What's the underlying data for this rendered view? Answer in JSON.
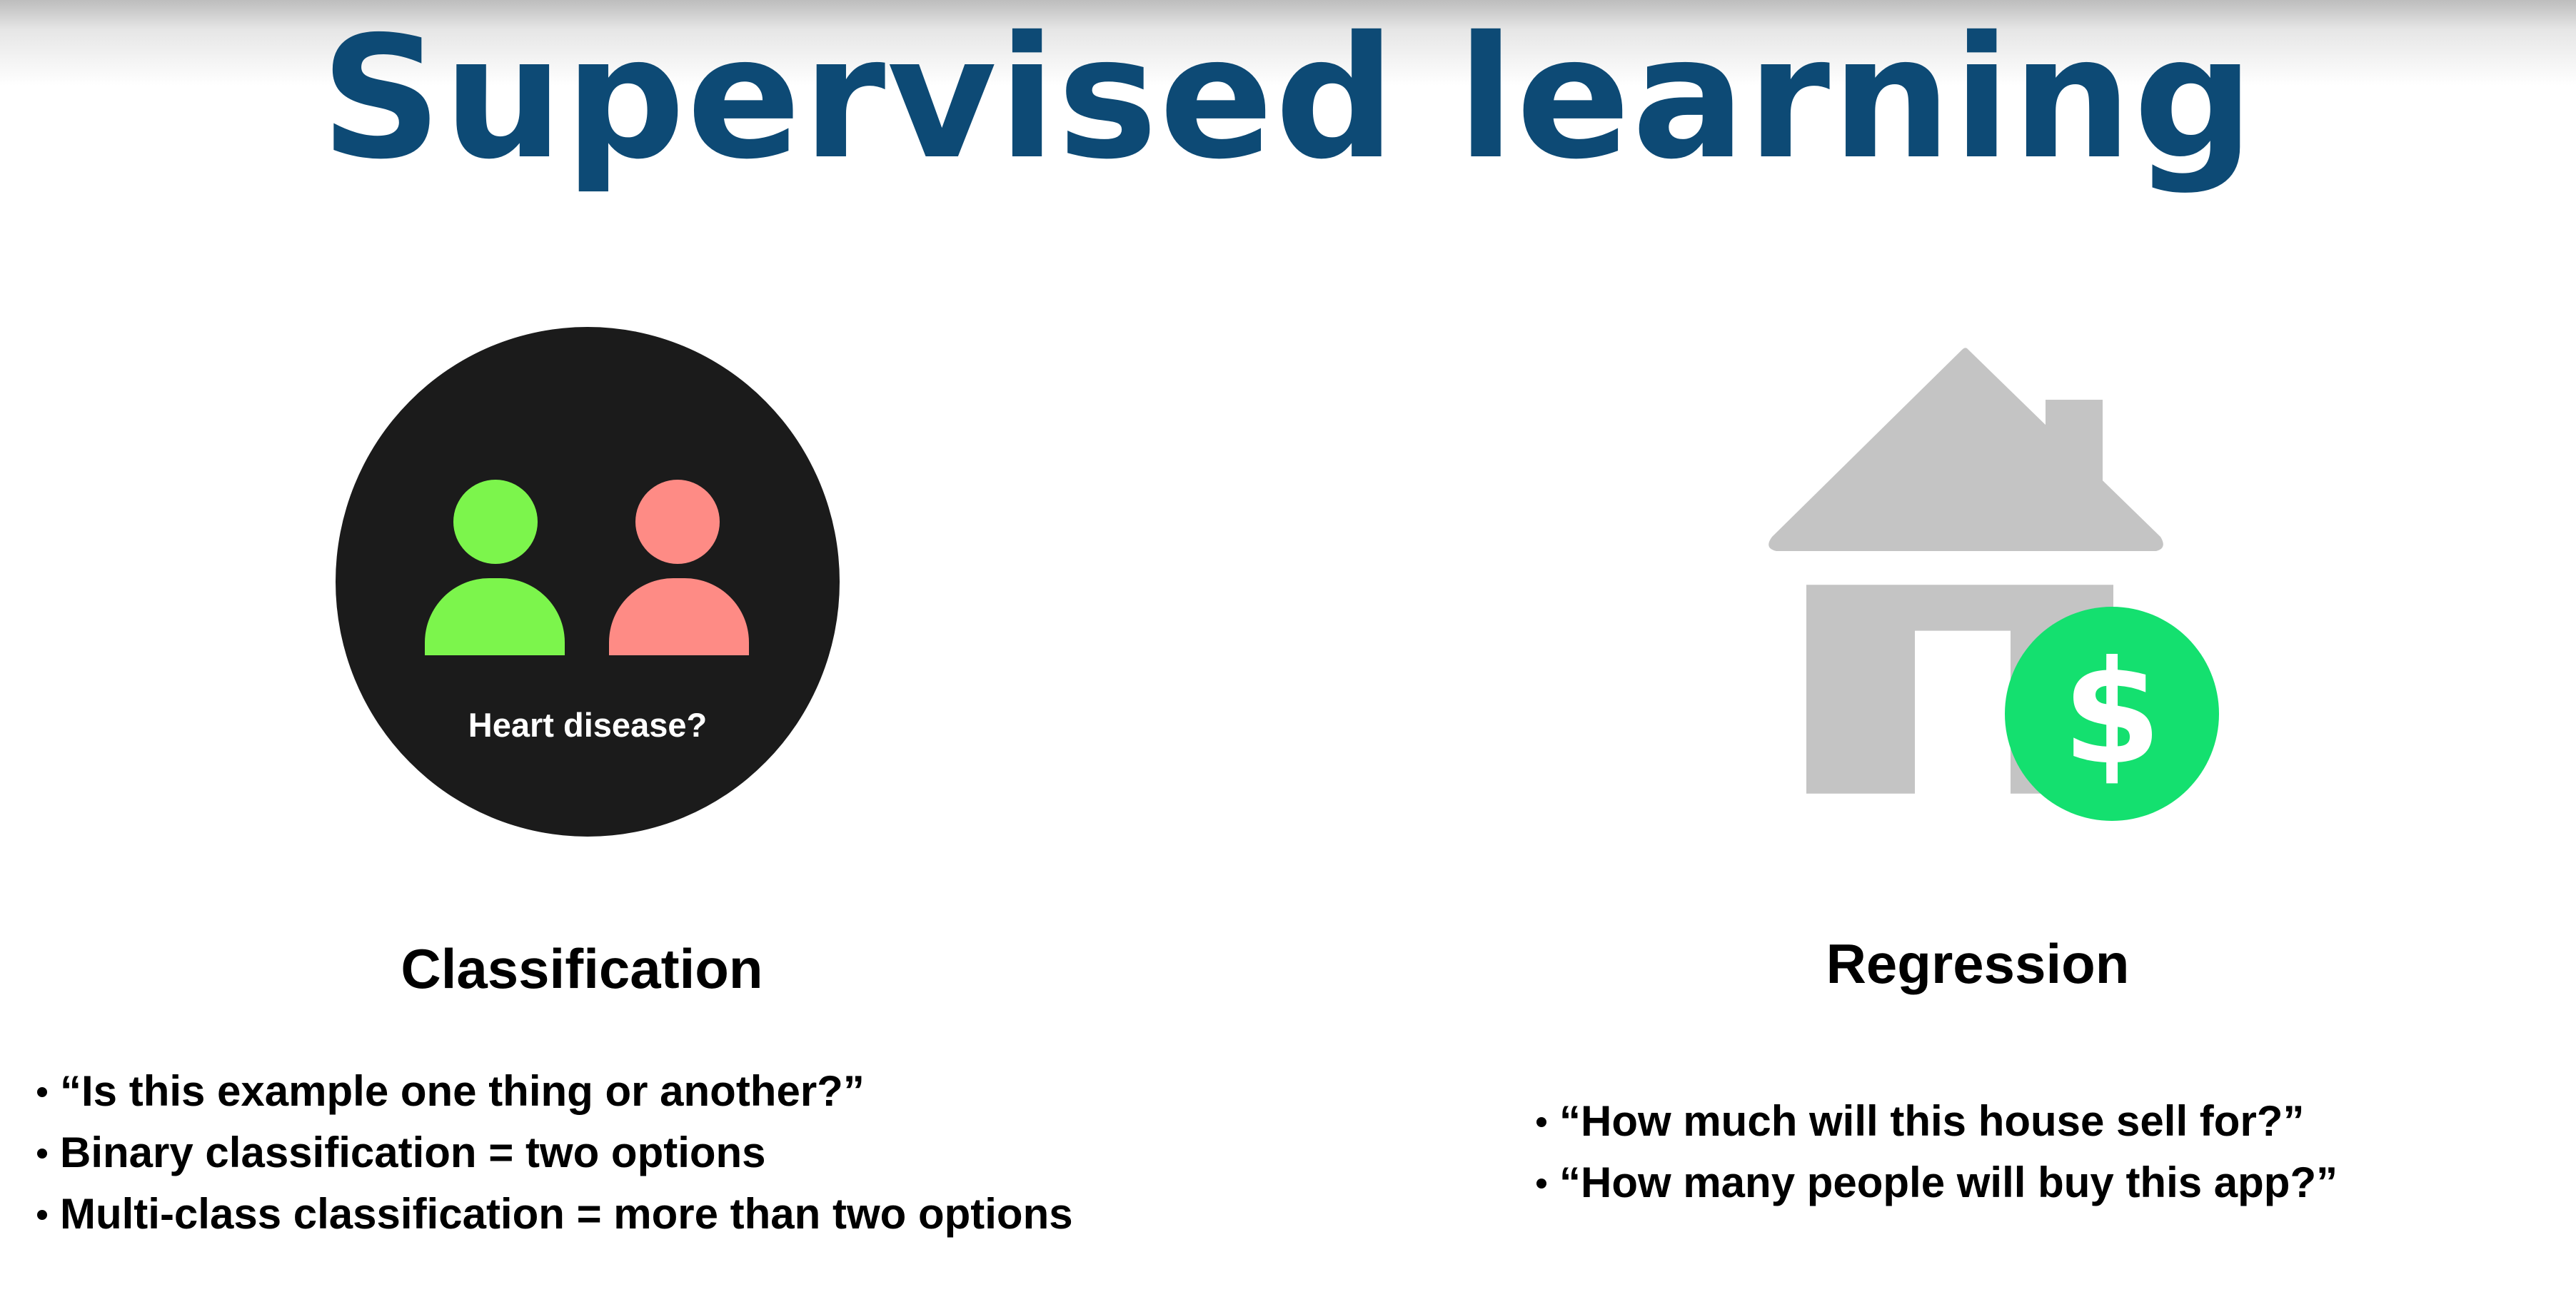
{
  "slide": {
    "title": "Supervised learning",
    "colors": {
      "title": "#0d4a75",
      "circle_background": "#1b1b1b",
      "person_healthy": "#7cf54c",
      "person_diseased": "#fe8b85",
      "house": "#c4c4c4",
      "dollar_badge": "#14e06f"
    }
  },
  "classification": {
    "illustration_caption": "Heart disease?",
    "icons": [
      "person-icon-green",
      "person-icon-red"
    ],
    "heading": "Classification",
    "bullets": [
      "“Is this example one thing or another?”",
      "Binary classification = two options",
      "Multi-class classification = more than two options"
    ]
  },
  "regression": {
    "icons": [
      "house-icon",
      "dollar-icon"
    ],
    "dollar_symbol": "$",
    "heading": "Regression",
    "bullets": [
      "“How much will this house sell for?”",
      "“How many people will buy this app?”"
    ]
  }
}
